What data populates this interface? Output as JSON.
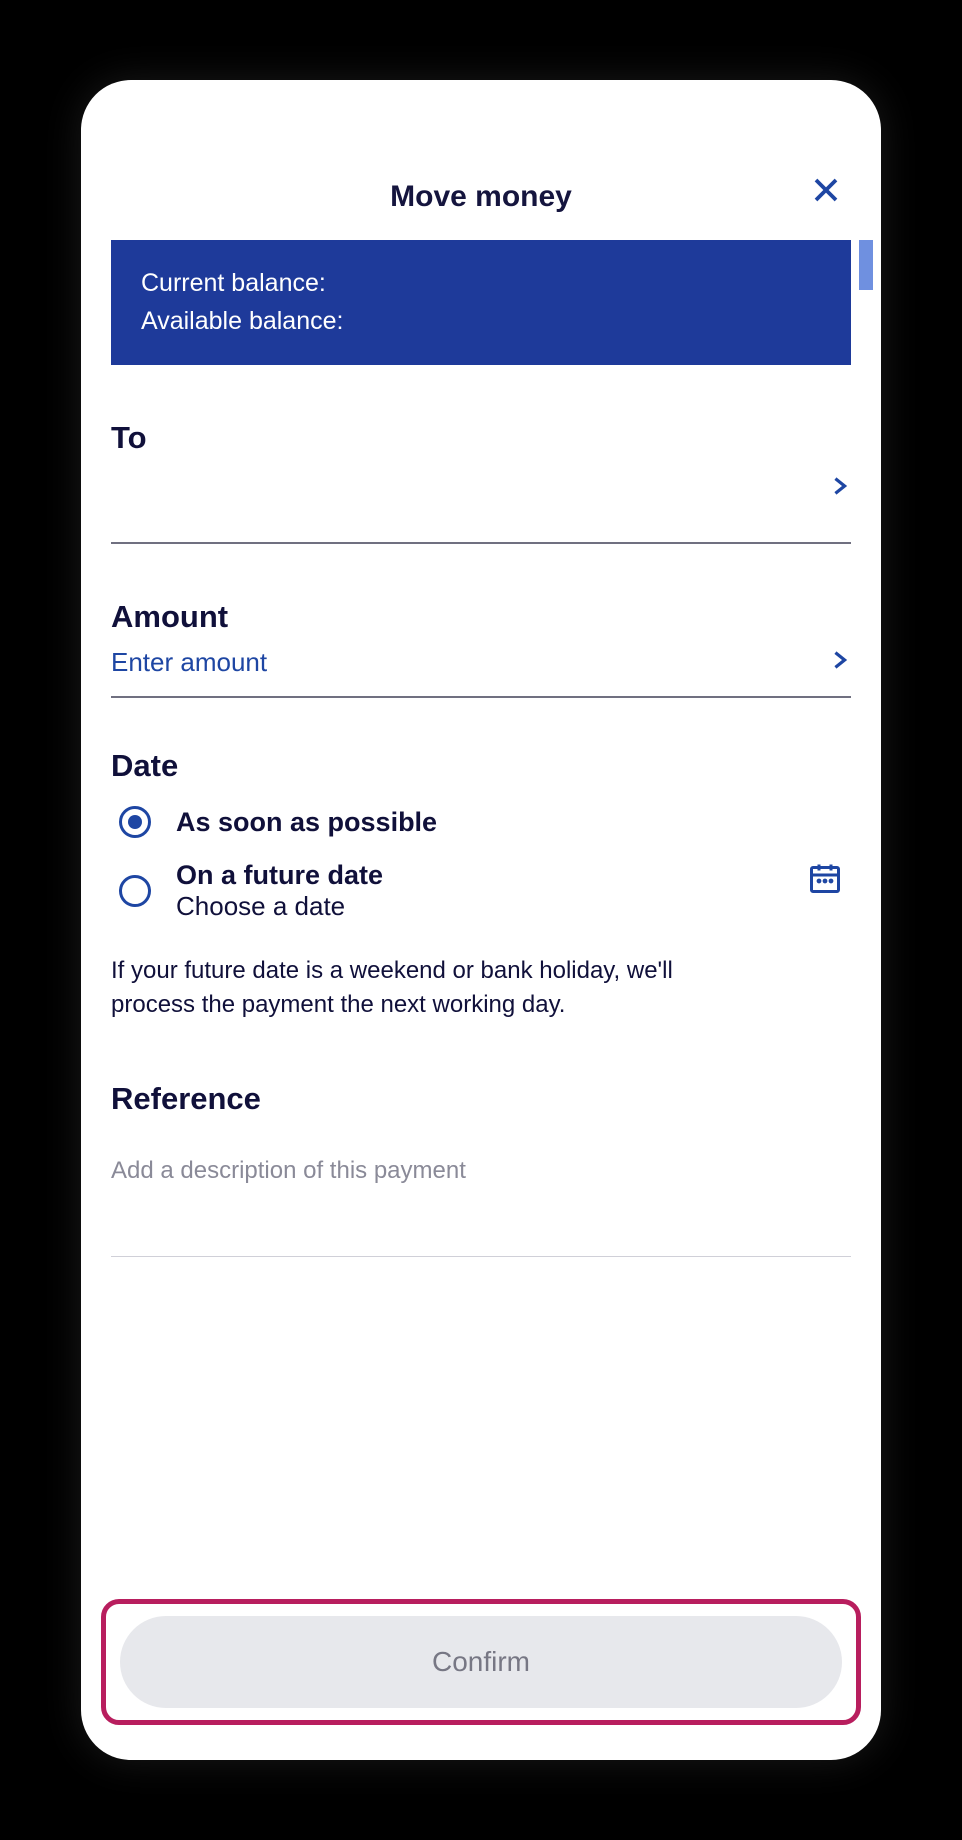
{
  "header": {
    "title": "Move money"
  },
  "balance": {
    "current_label": "Current balance:",
    "available_label": "Available balance:"
  },
  "to": {
    "label": "To",
    "value": ""
  },
  "amount": {
    "label": "Amount",
    "placeholder": "Enter amount"
  },
  "date": {
    "label": "Date",
    "options": [
      {
        "title": "As soon as possible",
        "subtitle": "",
        "selected": true
      },
      {
        "title": "On a future date",
        "subtitle": "Choose a date",
        "selected": false
      }
    ],
    "note": "If your future date is a weekend or bank holiday, we'll process the payment the next working day."
  },
  "reference": {
    "label": "Reference",
    "placeholder": "Add a description of this payment"
  },
  "confirm": {
    "label": "Confirm"
  }
}
